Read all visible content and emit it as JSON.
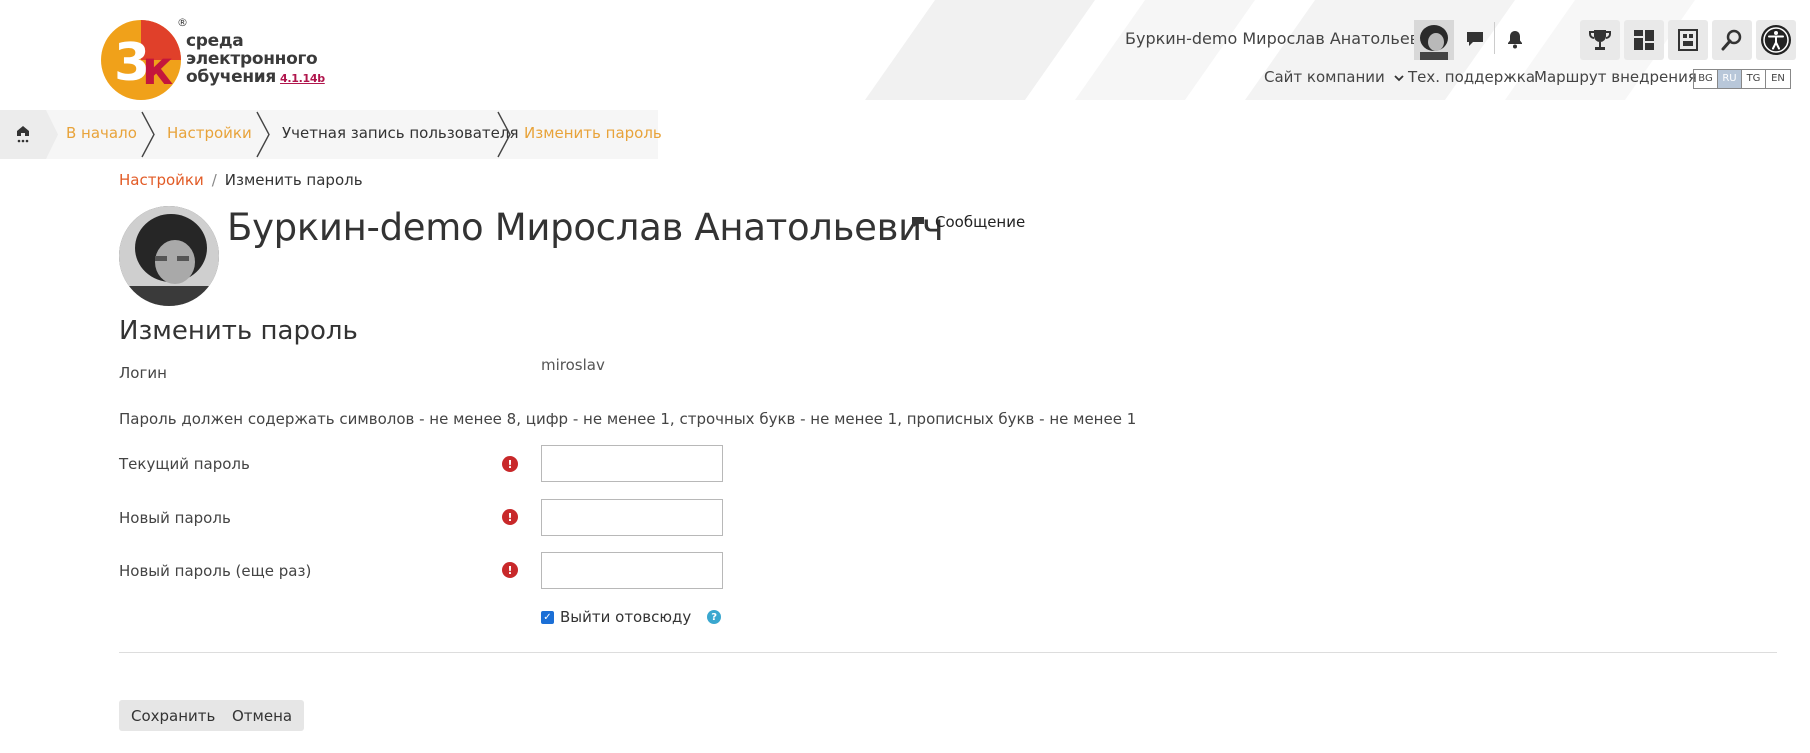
{
  "logo": {
    "line1": "среда",
    "line2": "электронного",
    "line3": "обучения",
    "version": "4.1.14b",
    "reg": "®"
  },
  "header": {
    "user_name": "Буркин-demo Мирослав Анатольевич",
    "links": [
      "Сайт компании",
      "Тех. поддержка",
      "Маршрут внедрения"
    ],
    "languages": [
      "BG",
      "RU",
      "TG",
      "EN"
    ],
    "active_language": "RU"
  },
  "breadcrumb": [
    "В начало",
    "Настройки",
    "Учетная запись пользователя",
    "Изменить пароль"
  ],
  "sub_breadcrumb": {
    "link": "Настройки",
    "separator": "/",
    "current": "Изменить пароль"
  },
  "profile": {
    "name": "Буркин-demo Мирослав Анатольевич",
    "message_label": "Сообщение"
  },
  "form": {
    "title": "Изменить пароль",
    "login_label": "Логин",
    "login_value": "miroslav",
    "rule_text": "Пароль должен содержать символов - не менее 8, цифр - не менее 1, строчных букв - не менее 1, прописных букв - не менее 1",
    "current_password_label": "Текущий пароль",
    "new_password_label": "Новый пароль",
    "new_password_again_label": "Новый пароль (еще раз)",
    "required_icon": "!",
    "logout_label": "Выйти отовсюду",
    "logout_checked": true,
    "help_icon": "?",
    "save_label": "Сохранить",
    "cancel_label": "Отмена"
  },
  "colors": {
    "breadcrumb_link": "#e8a33a",
    "sub_link": "#e25b26",
    "required": "#c8282a",
    "help": "#3aa7cf",
    "logo_orange": "#f0a11a",
    "logo_red": "#e0402a",
    "version": "#b0154c"
  }
}
